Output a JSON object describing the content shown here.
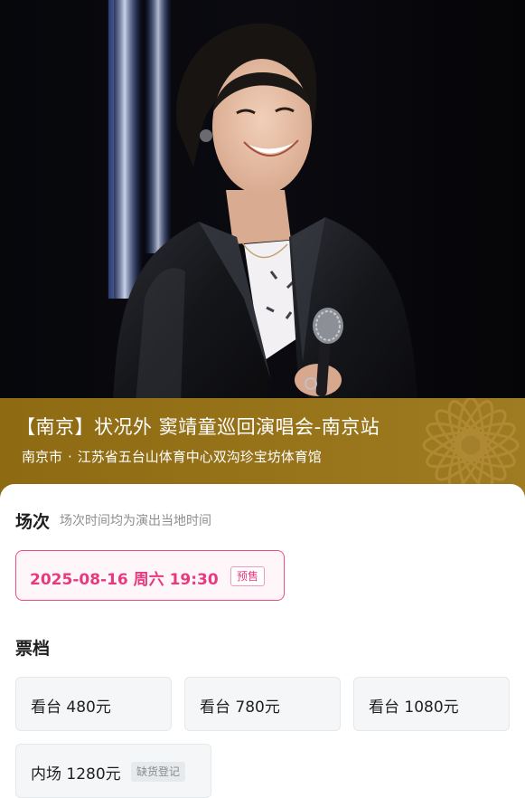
{
  "event": {
    "title": "【南京】状况外  窦靖童巡回演唱会-南京站",
    "city": "南京市",
    "separator": "·",
    "venue": "江苏省五台山体育中心双沟珍宝坊体育馆"
  },
  "sessions": {
    "heading": "场次",
    "note": "场次时间均为演出当地时间",
    "items": [
      {
        "label": "2025-08-16  周六 19:30",
        "tag": "预售",
        "selected": true
      }
    ]
  },
  "tiers": {
    "heading": "票档",
    "items": [
      {
        "label": "看台 480元"
      },
      {
        "label": "看台 780元"
      },
      {
        "label": "看台 1080元"
      },
      {
        "label": "内场 1280元",
        "tag": "缺货登记"
      }
    ]
  },
  "colors": {
    "accent_pink": "#e63a80",
    "band_gold": "#97731a",
    "tier_bg": "#f4f6f7"
  }
}
